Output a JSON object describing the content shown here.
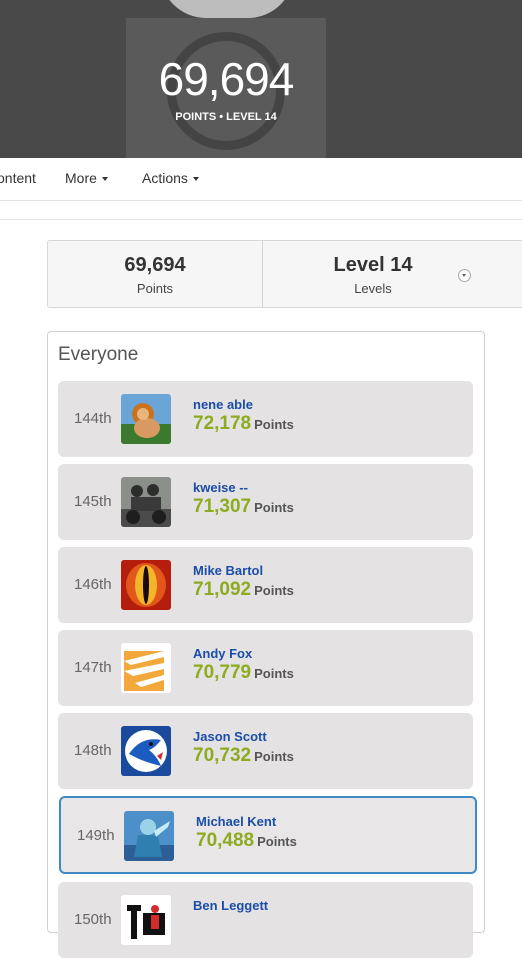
{
  "header": {
    "points": "69,694",
    "subtitle": "POINTS • LEVEL 14"
  },
  "nav": {
    "items": [
      "ontent",
      "More",
      "Actions"
    ]
  },
  "stats": {
    "points": {
      "value": "69,694",
      "label": "Points"
    },
    "level": {
      "value": "Level 14",
      "label": "Levels"
    }
  },
  "leaderboard": {
    "title": "Everyone",
    "points_label": "Points",
    "rows": [
      {
        "rank": "144th",
        "name": "nene able",
        "points": "72,178",
        "avatar": "lion-avatar"
      },
      {
        "rank": "145th",
        "name": "kweise --",
        "points": "71,307",
        "avatar": "motorcycle-avatar"
      },
      {
        "rank": "146th",
        "name": "Mike Bartol",
        "points": "71,092",
        "avatar": "eye-avatar"
      },
      {
        "rank": "147th",
        "name": "Andy Fox",
        "points": "70,779",
        "avatar": "orange-logo-avatar"
      },
      {
        "rank": "148th",
        "name": "Jason Scott",
        "points": "70,732",
        "avatar": "blue-jays-avatar"
      },
      {
        "rank": "149th",
        "name": "Michael Kent",
        "points": "70,488",
        "avatar": "robot-avatar"
      },
      {
        "rank": "150th",
        "name": "Ben Leggett",
        "points": "",
        "avatar": "sign-avatar"
      }
    ]
  },
  "colors": {
    "points_green": "#8dab21",
    "name_blue": "#1b4ea8",
    "highlight_border": "#3f89c4"
  }
}
